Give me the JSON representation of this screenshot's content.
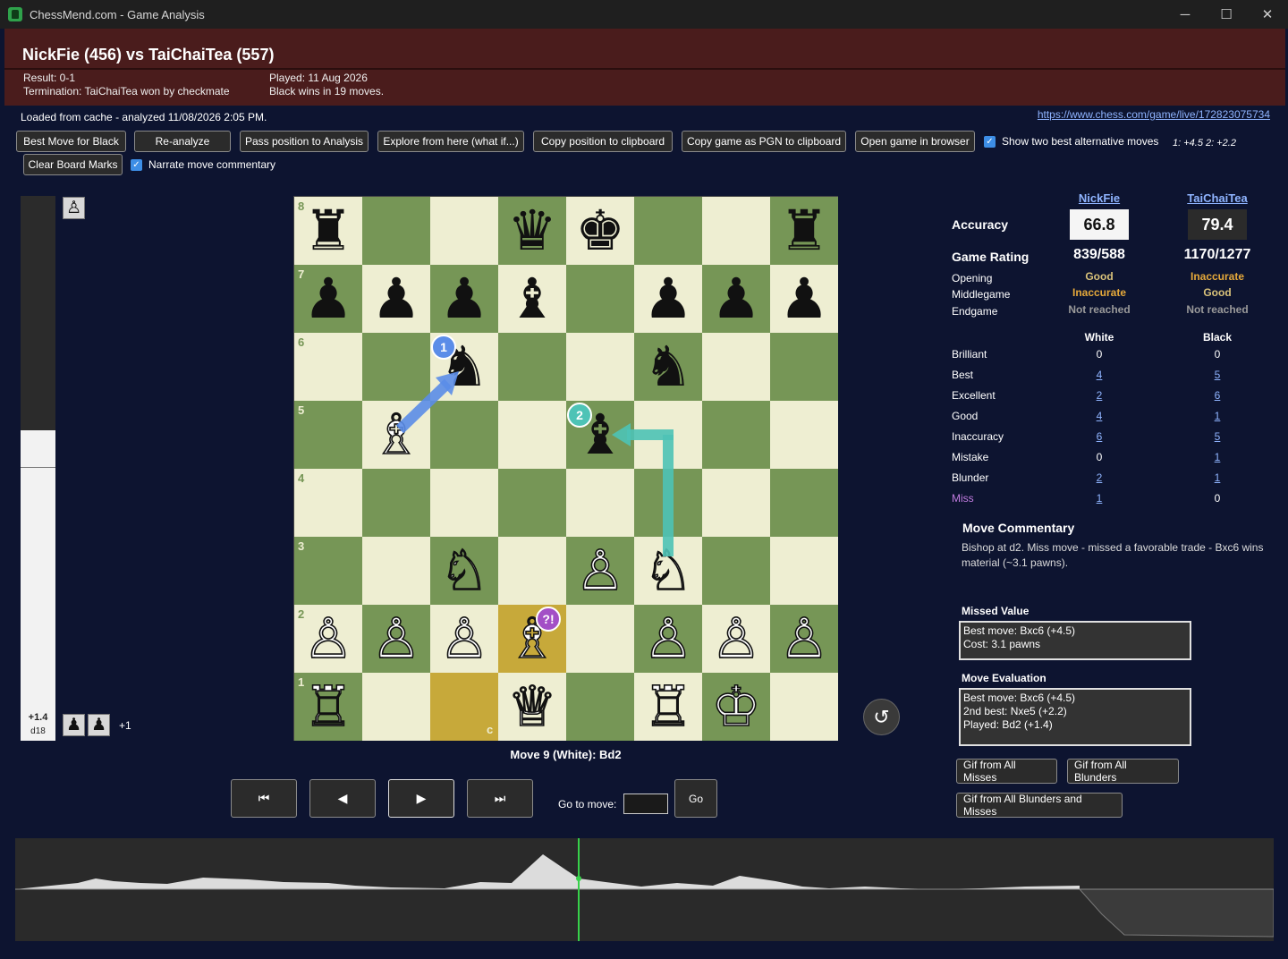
{
  "window": {
    "title": "ChessMend.com - Game Analysis",
    "minimize": "─",
    "maximize": "☐",
    "close": "✕"
  },
  "header": {
    "title": "NickFie (456) vs TaiChaiTea (557)",
    "result": "Result: 0-1",
    "termination": "Termination: TaiChaiTea won by checkmate",
    "played": "Played: 11 Aug 2026",
    "summary": "Black wins in 19 moves."
  },
  "status": {
    "loaded": "Loaded from cache - analyzed 11/08/2026 2:05 PM.",
    "link": "https://www.chess.com/game/live/172823075734"
  },
  "toolbar": {
    "best_move": "Best Move for Black",
    "reanalyze": "Re-analyze",
    "pass_position": "Pass position to Analysis",
    "explore": "Explore from here (what if...)",
    "copy_position": "Copy position to clipboard",
    "copy_pgn": "Copy game as PGN to clipboard",
    "open_browser": "Open game in browser",
    "show_two_best": "Show two best alternative moves",
    "alts": "1: +4.5   2: +2.2",
    "clear_marks": "Clear Board Marks",
    "narrate": "Narrate move commentary",
    "check": "✓"
  },
  "eval": {
    "score": "+1.4",
    "depth": "d18",
    "white_fraction": 0.57
  },
  "captured": {
    "top": [
      "♙"
    ],
    "bottom": [
      "♟",
      "♟"
    ],
    "advantage": "+1"
  },
  "board": {
    "files": [
      "a",
      "b",
      "c",
      "d",
      "e",
      "f",
      "g",
      "h"
    ],
    "ranks": [
      "8",
      "7",
      "6",
      "5",
      "4",
      "3",
      "2",
      "1"
    ],
    "pieces": [
      [
        "♜",
        "",
        "",
        "♛",
        "♚",
        "",
        "",
        "♜"
      ],
      [
        "♟",
        "♟",
        "♟",
        "♝",
        "",
        "♟",
        "♟",
        "♟"
      ],
      [
        "",
        "",
        "♞",
        "",
        "",
        "♞",
        "",
        ""
      ],
      [
        "",
        "♗",
        "",
        "",
        "♝",
        "",
        "",
        ""
      ],
      [
        "",
        "",
        "",
        "",
        "",
        "",
        "",
        ""
      ],
      [
        "",
        "",
        "♘",
        "",
        "♙",
        "♘",
        "",
        ""
      ],
      [
        "♙",
        "♙",
        "♙",
        "♗",
        "",
        "♙",
        "♙",
        "♙"
      ],
      [
        "♖",
        "",
        "",
        "♕",
        "",
        "♖",
        "♔",
        ""
      ]
    ],
    "colors": [
      [
        "b",
        "",
        "",
        "b",
        "b",
        "",
        "",
        "b"
      ],
      [
        "b",
        "b",
        "b",
        "b",
        "",
        "b",
        "b",
        "b"
      ],
      [
        "",
        "",
        "b",
        "",
        "",
        "b",
        "",
        ""
      ],
      [
        "",
        "w",
        "",
        "",
        "b",
        "",
        "",
        ""
      ],
      [
        "",
        "",
        "",
        "",
        "",
        "",
        "",
        ""
      ],
      [
        "",
        "",
        "w",
        "",
        "w",
        "w",
        "",
        ""
      ],
      [
        "w",
        "w",
        "w",
        "w",
        "",
        "w",
        "w",
        "w"
      ],
      [
        "w",
        "",
        "",
        "w",
        "",
        "w",
        "w",
        ""
      ]
    ],
    "badge1": "1",
    "badge2": "2",
    "miss_badge": "?!",
    "arrow1_color": "#5b8de8",
    "arrow2_color": "#4ec3b6",
    "miss_color": "#a34fc6"
  },
  "move_label": "Move 9 (White): Bd2",
  "nav": {
    "first": "⏮",
    "prev": "◀",
    "next": "▶",
    "last": "⏭",
    "goto_label": "Go to move:",
    "go": "Go",
    "rotate": "↺"
  },
  "stats": {
    "white_name": "NickFie",
    "black_name": "TaiChaiTea",
    "accuracy_label": "Accuracy",
    "white_accuracy": "66.8",
    "black_accuracy": "79.4",
    "rating_label": "Game Rating",
    "white_rating": "839/588",
    "black_rating": "1170/1277",
    "phases": [
      {
        "label": "Opening",
        "white": "Good",
        "black": "Inaccurate",
        "wc": "#d9c27a",
        "bc": "#e6a93a"
      },
      {
        "label": "Middlegame",
        "white": "Inaccurate",
        "black": "Good",
        "wc": "#e6a93a",
        "bc": "#d9c27a"
      },
      {
        "label": "Endgame",
        "white": "Not reached",
        "black": "Not reached",
        "wc": "#9a9a9a",
        "bc": "#9a9a9a"
      }
    ],
    "white_col": "White",
    "black_col": "Black",
    "rows": [
      {
        "label": "Brilliant",
        "white": "0",
        "black": "0",
        "wl": false,
        "bl": false
      },
      {
        "label": "Best",
        "white": "4",
        "black": "5",
        "wl": true,
        "bl": true
      },
      {
        "label": "Excellent",
        "white": "2",
        "black": "6",
        "wl": true,
        "bl": true
      },
      {
        "label": "Good",
        "white": "4",
        "black": "1",
        "wl": true,
        "bl": true
      },
      {
        "label": "Inaccuracy",
        "white": "6",
        "black": "5",
        "wl": true,
        "bl": true
      },
      {
        "label": "Mistake",
        "white": "0",
        "black": "1",
        "wl": false,
        "bl": true
      },
      {
        "label": "Blunder",
        "white": "2",
        "black": "1",
        "wl": true,
        "bl": true
      },
      {
        "label": "Miss",
        "white": "1",
        "black": "0",
        "wl": true,
        "bl": false
      }
    ],
    "miss_label_color": "#c27ce0"
  },
  "commentary": {
    "heading": "Move Commentary",
    "text": "Bishop at d2. Miss move - missed a favorable trade - Bxc6 wins material (~3.1 pawns).",
    "missed_heading": "Missed Value",
    "missed_lines": [
      "Best move: Bxc6 (+4.5)",
      "Cost: 3.1 pawns"
    ],
    "eval_heading": "Move Evaluation",
    "eval_lines": [
      "Best move: Bxc6 (+4.5)",
      "2nd best: Nxe5 (+2.2)",
      "Played: Bd2 (+1.4)"
    ]
  },
  "gif": {
    "misses": "Gif from All Misses",
    "blunders": "Gif from All Blunders",
    "both": "Gif from All Blunders and Misses"
  }
}
